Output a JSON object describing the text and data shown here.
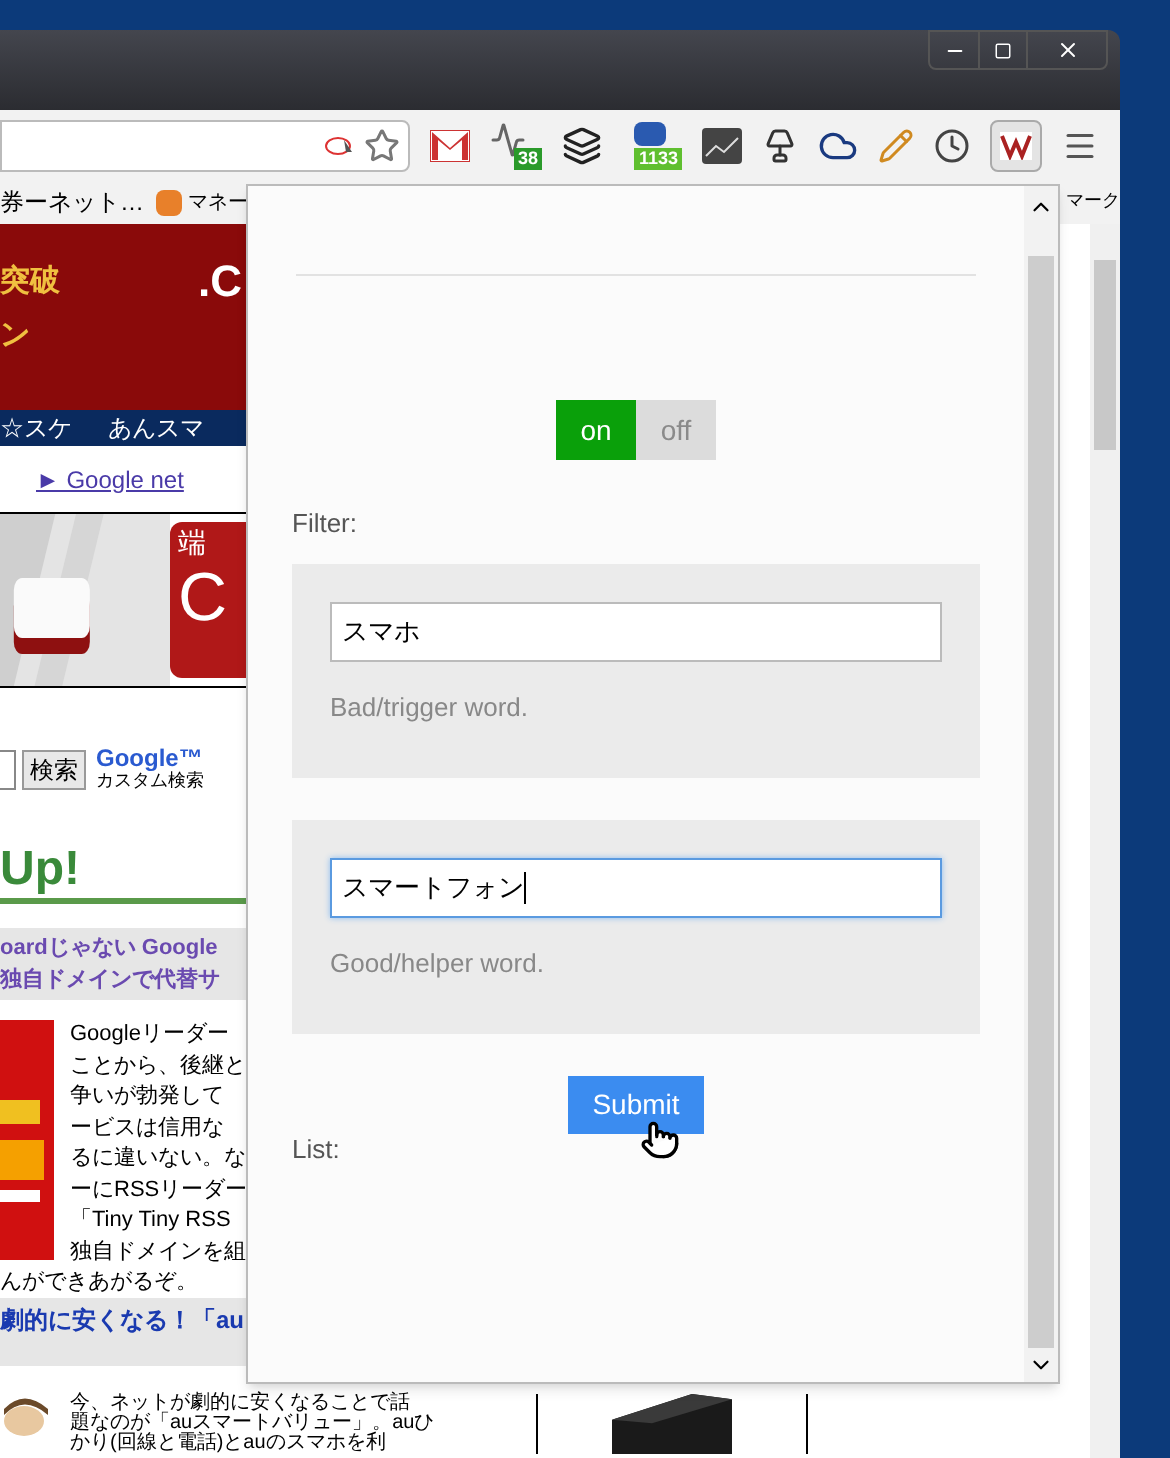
{
  "toolbar": {
    "badges": [
      "38",
      "1133"
    ]
  },
  "bookmarks": [
    {
      "label": "券ーネット…"
    },
    {
      "label": "マネー"
    },
    {
      "label": "マーク"
    }
  ],
  "page": {
    "banner": [
      "突破",
      "ン",
      ".C"
    ],
    "nav": [
      "☆スケ",
      "あんスマ"
    ],
    "link": "► Google net",
    "ad": [
      "端",
      "C"
    ],
    "search": {
      "button": "検索",
      "logo": "Google™",
      "logo_sub": "カスタム検索"
    },
    "heading": "Up!",
    "article1": {
      "title": [
        "oardじゃない Google",
        "独自ドメインで代替サ"
      ],
      "lines": [
        "Googleリーダー",
        "ことから、後継と",
        "争いが勃発して",
        "ービスは信用な",
        "るに違いない。な",
        "ーにRSSリーダー",
        "「Tiny Tiny RSS",
        "独自ドメインを組"
      ],
      "tail": "んができあがるぞ。"
    },
    "article2": {
      "title": "劇的に安くなる！「au",
      "lines": [
        "今、ネットが劇的に安くなることで話",
        "題なのが「auスマートバリュー」。auひ",
        "かり(回線と電話)とauのスマホを利"
      ]
    }
  },
  "popup": {
    "toggle": [
      {
        "label": "on",
        "selected": true
      },
      {
        "label": "off",
        "selected": false
      }
    ],
    "filter_label": "Filter:",
    "fields": [
      {
        "value": "スマホ",
        "hint": "Bad/trigger word.",
        "focused": false
      },
      {
        "value": "スマートフォン",
        "hint": "Good/helper word.",
        "focused": true
      }
    ],
    "submit": "Submit",
    "list_label": "List:"
  }
}
